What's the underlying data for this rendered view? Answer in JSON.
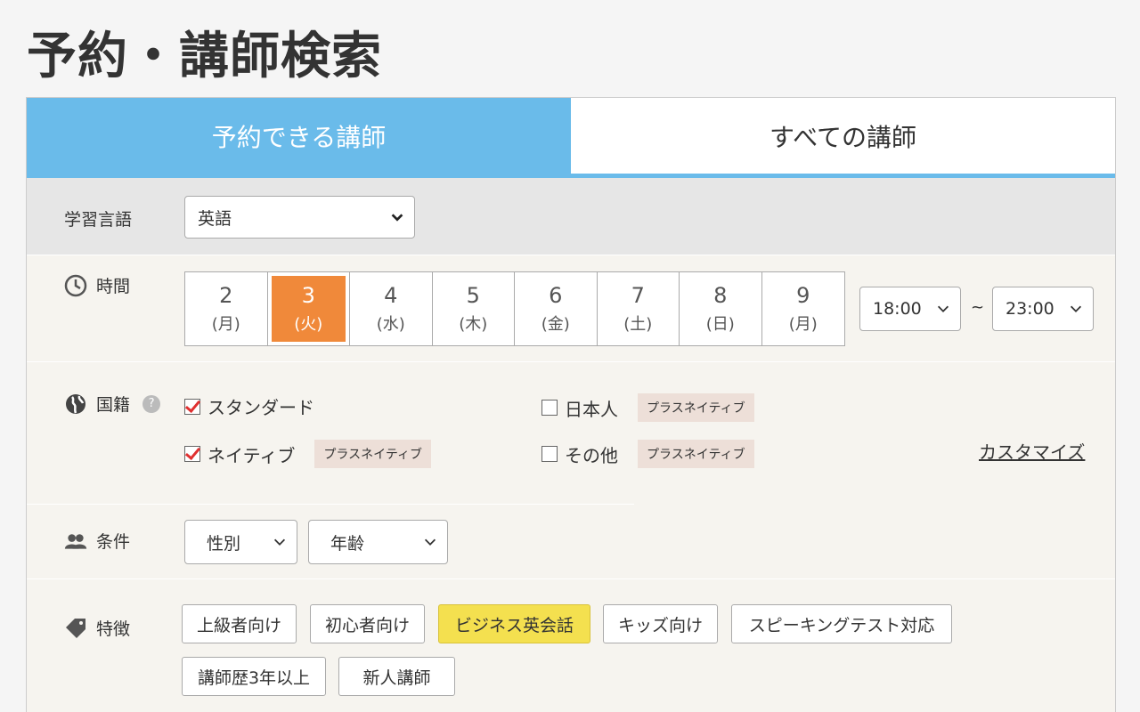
{
  "page": {
    "title": "予約・講師検索"
  },
  "tabs": [
    {
      "label": "予約できる講師",
      "active": true
    },
    {
      "label": "すべての講師",
      "active": false
    }
  ],
  "language": {
    "label": "学習言語",
    "selected": "英語"
  },
  "time": {
    "label": "時間",
    "dates": [
      {
        "num": "2",
        "dow": "(月)"
      },
      {
        "num": "3",
        "dow": "(火)",
        "selected": true
      },
      {
        "num": "4",
        "dow": "(水)"
      },
      {
        "num": "5",
        "dow": "(木)"
      },
      {
        "num": "6",
        "dow": "(金)"
      },
      {
        "num": "7",
        "dow": "(土)"
      },
      {
        "num": "8",
        "dow": "(日)"
      },
      {
        "num": "9",
        "dow": "(月)"
      }
    ],
    "from": "18:00",
    "separator": "~",
    "to": "23:00"
  },
  "nationality": {
    "label": "国籍",
    "help": "?",
    "options": [
      {
        "label": "スタンダード",
        "checked": true,
        "badge": ""
      },
      {
        "label": "ネイティブ",
        "checked": true,
        "badge": "プラスネイティブ"
      },
      {
        "label": "日本人",
        "checked": false,
        "badge": "プラスネイティブ"
      },
      {
        "label": "その他",
        "checked": false,
        "badge": "プラスネイティブ"
      }
    ],
    "customize": "カスタマイズ"
  },
  "conditions": {
    "label": "条件",
    "gender": "性別",
    "age": "年齢"
  },
  "features": {
    "label": "特徴",
    "chips": [
      {
        "label": "上級者向け",
        "active": false
      },
      {
        "label": "初心者向け",
        "active": false
      },
      {
        "label": "ビジネス英会話",
        "active": true
      },
      {
        "label": "キッズ向け",
        "active": false
      },
      {
        "label": "スピーキングテスト対応",
        "active": false
      },
      {
        "label": "講師歴3年以上",
        "active": false
      },
      {
        "label": "新人講師",
        "active": false
      }
    ]
  },
  "colors": {
    "tab_active": "#6abbea",
    "date_selected": "#f0893a",
    "chip_active": "#f4e04f",
    "check_mark": "#e03030"
  }
}
